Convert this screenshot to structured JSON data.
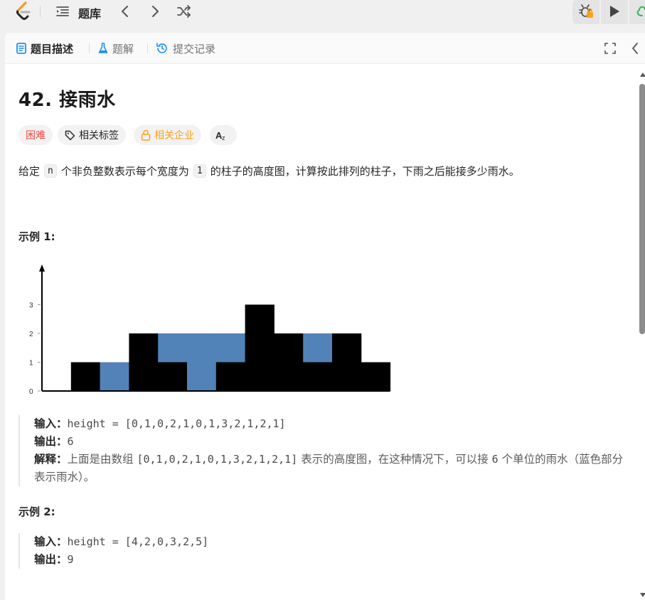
{
  "nav": {
    "title": "题库"
  },
  "tabs": [
    {
      "label": "题目描述",
      "active": true
    },
    {
      "label": "题解",
      "active": false
    },
    {
      "label": "提交记录",
      "active": false
    }
  ],
  "problem": {
    "title": "42. 接雨水",
    "tags": {
      "difficulty": "困难",
      "topics": "相关标签",
      "companies": "相关企业",
      "translate": "Aあ"
    },
    "desc": {
      "part1": "给定",
      "code1": "n",
      "part2": "个非负整数表示每个宽度为",
      "code2": "1",
      "part3": "的柱子的高度图，计算按此排列的柱子，下雨之后能接多少雨水。"
    },
    "example1": {
      "title": "示例 1:",
      "input_label": "输入：",
      "input": "height = [0,1,0,2,1,0,1,3,2,1,2,1]",
      "output_label": "输出：",
      "output": "6",
      "explain_label": "解释：",
      "explain_pre": "上面是由数组",
      "explain_arr": "[0,1,0,2,1,0,1,3,2,1,2,1]",
      "explain_mid": "表示的高度图，在这种情况下，可以接",
      "explain_num": "6",
      "explain_post": "个单位的雨水（蓝色部分表示雨水）。"
    },
    "example2": {
      "title": "示例 2:",
      "input_label": "输入：",
      "input": "height = [4,2,0,3,2,5]",
      "output_label": "输出：",
      "output": "9"
    }
  },
  "colors": {
    "accent": "#ffa116",
    "hard": "#ef4743",
    "water": "#5183b8",
    "bar": "#000000"
  },
  "chart_data": {
    "type": "bar",
    "x": [
      0,
      1,
      2,
      3,
      4,
      5,
      6,
      7,
      8,
      9,
      10,
      11
    ],
    "values": [
      0,
      1,
      0,
      2,
      1,
      0,
      1,
      3,
      2,
      1,
      2,
      1
    ],
    "water": [
      0,
      0,
      1,
      0,
      1,
      2,
      1,
      0,
      0,
      1,
      0,
      0
    ],
    "yticks": [
      "0",
      "1",
      "2",
      "3"
    ],
    "ylim": [
      0,
      4
    ]
  }
}
